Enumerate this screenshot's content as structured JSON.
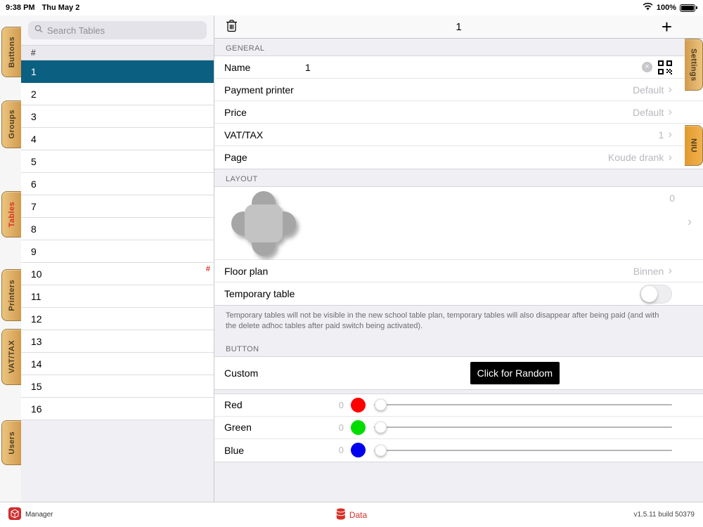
{
  "status_bar": {
    "time": "9:38 PM",
    "date": "Thu May 2",
    "battery": "100%"
  },
  "left_tabs": [
    {
      "label": "Buttons"
    },
    {
      "label": "Groups"
    },
    {
      "label": "Tables",
      "active": true
    },
    {
      "label": "Printers"
    },
    {
      "label": "VAT/TAX"
    },
    {
      "label": "Users"
    }
  ],
  "right_tabs": [
    {
      "label": "Settings"
    },
    {
      "label": "NIU",
      "highlight": true
    }
  ],
  "sidebar": {
    "search_placeholder": "Search Tables",
    "section_header": "#",
    "index_marker": "#",
    "items": [
      "1",
      "2",
      "3",
      "4",
      "5",
      "6",
      "7",
      "8",
      "9",
      "10",
      "11",
      "12",
      "13",
      "14",
      "15",
      "16"
    ],
    "selected": "1"
  },
  "toolbar": {
    "title": "1",
    "add_label": "+"
  },
  "icons": {
    "chevron": "›",
    "clear": "×"
  },
  "form": {
    "general": {
      "header": "GENERAL",
      "name_label": "Name",
      "name_value": "1",
      "rows": [
        {
          "label": "Payment printer",
          "value": "Default"
        },
        {
          "label": "Price",
          "value": "Default"
        },
        {
          "label": "VAT/TAX",
          "value": "1"
        },
        {
          "label": "Page",
          "value": "Koude drank"
        }
      ]
    },
    "layout": {
      "header": "LAYOUT",
      "shape_value": "0",
      "floor_plan_label": "Floor plan",
      "floor_plan_value": "Binnen",
      "temporary_label": "Temporary table",
      "temporary_on": false,
      "footnote": "Temporary tables will not be visible in the new school table plan, temporary tables will also disappear after being paid (and with the delete adhoc tables after paid switch being activated)."
    },
    "button": {
      "header": "BUTTON",
      "custom_label": "Custom",
      "random_button_label": "Click for Random",
      "sliders": [
        {
          "label": "Red",
          "value": "0",
          "color": "#ff0000"
        },
        {
          "label": "Green",
          "value": "0",
          "color": "#00dc00"
        },
        {
          "label": "Blue",
          "value": "0",
          "color": "#0000ee"
        }
      ]
    }
  },
  "bottom_bar": {
    "manager_label": "Manager",
    "data_label": "Data",
    "version": "v1.5.11 build 50379"
  },
  "colors": {
    "accent_red": "#d93025",
    "selected_row": "#0b5f80",
    "tab_tan": "#ddab60",
    "tab_highlight": "#e8a33d"
  }
}
